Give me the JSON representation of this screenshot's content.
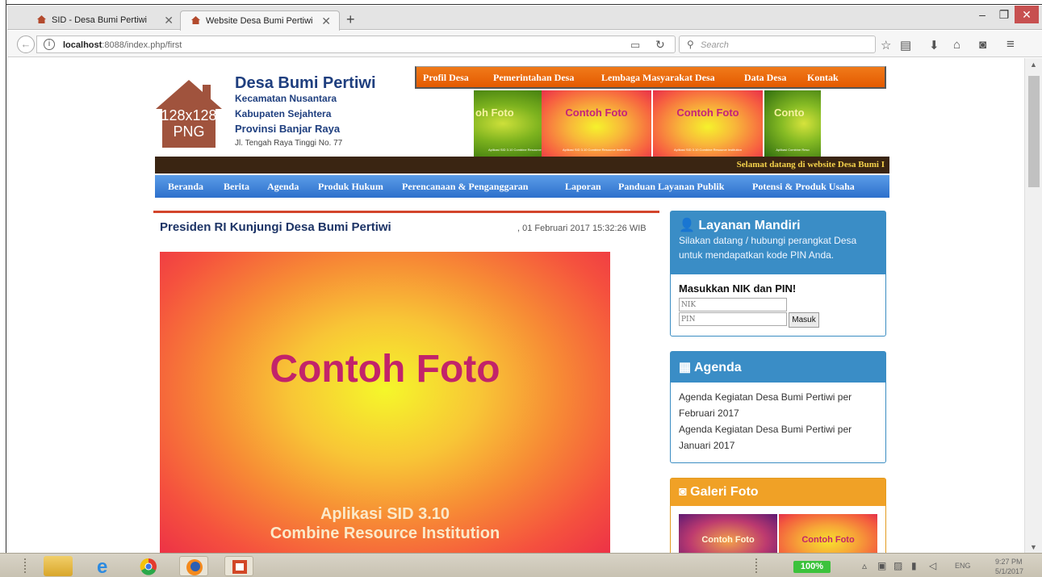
{
  "browser": {
    "tabs": [
      {
        "title": "SID - Desa Bumi Pertiwi",
        "active": false
      },
      {
        "title": "Website Desa Bumi Pertiwi",
        "active": true
      }
    ],
    "url_host": "localhost",
    "url_rest": ":8088/index.php/first",
    "search_placeholder": "Search",
    "icons": [
      "back-arrow-icon",
      "info-icon",
      "reader-view-icon",
      "reload-icon",
      "search-icon",
      "bookmark-star-icon",
      "reading-list-icon",
      "download-icon",
      "home-icon",
      "pocket-icon",
      "menu-icon"
    ]
  },
  "site": {
    "title": "Desa Bumi Pertiwi",
    "kecamatan": "Kecamatan Nusantara",
    "kabupaten": "Kabupaten Sejahtera",
    "provinsi": "Provinsi Banjar Raya",
    "address": "Jl. Tengah Raya Tinggi No. 77",
    "logo_text_line1": "128x128",
    "logo_text_line2": "PNG",
    "top_menu": [
      "Profil Desa",
      "Pemerintahan Desa",
      "Lembaga Masyarakat Desa",
      "Data Desa",
      "Kontak"
    ],
    "slides": [
      {
        "label": "oh Foto",
        "footer": "Aplikasi SID 3.10 Combine Resource Institution"
      },
      {
        "label": "Contoh Foto",
        "footer": "Aplikasi SID 3.10 Combine Resource Institution"
      },
      {
        "label": "Contoh Foto",
        "footer": "Aplikasi SID 3.10 Combine Resource Institution"
      },
      {
        "label": "Conto",
        "footer": "Aplikasi Combine Reso"
      }
    ],
    "marquee": "Selamat datang di website Desa Bumi I",
    "main_menu": [
      "Beranda",
      "Berita",
      "Agenda",
      "Produk Hukum",
      "Perencanaan & Penganggaran",
      "Laporan",
      "Panduan Layanan Publik",
      "Potensi & Produk Usaha"
    ]
  },
  "article": {
    "title": "Presiden RI Kunjungi Desa Bumi Pertiwi",
    "date": ", 01 Februari 2017 15:32:26 WIB",
    "image_title": "Contoh Foto",
    "image_sub1": "Aplikasi SID 3.10",
    "image_sub2": "Combine Resource Institution"
  },
  "widgets": {
    "layanan": {
      "title": "Layanan Mandiri",
      "desc": "Silakan datang / hubungi perangkat Desa untuk mendapatkan kode PIN Anda.",
      "label": "Masukkan NIK dan PIN!",
      "nik_placeholder": "NIK",
      "pin_placeholder": "PIN",
      "button": "Masuk"
    },
    "agenda": {
      "title": "Agenda",
      "items": [
        "Agenda Kegiatan Desa Bumi Pertiwi per Februari 2017",
        "Agenda Kegiatan Desa Bumi Pertiwi per Januari 2017"
      ]
    },
    "galeri": {
      "title": "Galeri Foto",
      "thumbs": [
        "Contoh Foto",
        "Contoh Foto"
      ]
    }
  },
  "taskbar": {
    "battery": "100%",
    "lang": "ENG",
    "time": "9:27 PM",
    "date": "5/1/2017"
  },
  "colors": {
    "top_menu": "#e8650c",
    "main_menu": "#3b7fd6",
    "widget_blue": "#3a8dc6",
    "widget_orange": "#f0a126",
    "article_title": "#1d3466",
    "close_button": "#c75050"
  }
}
